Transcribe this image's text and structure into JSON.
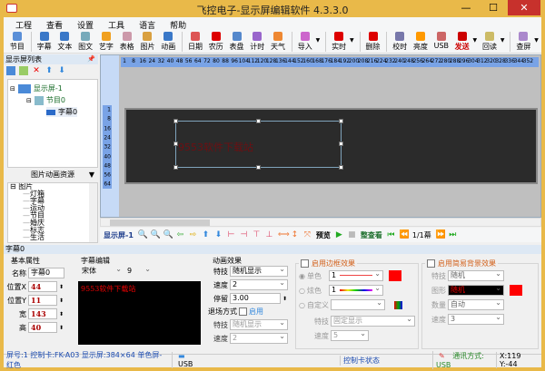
{
  "window": {
    "title": "飞控电子-显示屏编辑软件 4.3.3.0",
    "minimize": "—",
    "maximize": "☐",
    "close": "✕"
  },
  "menu": [
    "工程",
    "查看",
    "设置",
    "工具",
    "语言",
    "帮助"
  ],
  "toolbar": [
    {
      "label": "节目",
      "icon": "program-icon",
      "color": "#5a8fd8"
    },
    {
      "sep": true
    },
    {
      "label": "字幕",
      "icon": "subtitle-icon",
      "color": "#3a78c8"
    },
    {
      "label": "文本",
      "icon": "text-icon",
      "color": "#3a78c8"
    },
    {
      "label": "图文",
      "icon": "image-text-icon",
      "color": "#7ab"
    },
    {
      "label": "艺字",
      "icon": "art-text-icon",
      "color": "#f0a020"
    },
    {
      "label": "表格",
      "icon": "table-icon",
      "color": "#c9a"
    },
    {
      "label": "图片",
      "icon": "picture-icon",
      "color": "#d9a040"
    },
    {
      "label": "动画",
      "icon": "animation-icon",
      "color": "#3a78c8"
    },
    {
      "sep": true
    },
    {
      "label": "日期",
      "icon": "date-icon",
      "color": "#d55"
    },
    {
      "label": "农历",
      "icon": "lunar-icon",
      "color": "#d00"
    },
    {
      "label": "表盘",
      "icon": "clock-icon",
      "color": "#58c"
    },
    {
      "label": "计时",
      "icon": "timer-icon",
      "color": "#96c"
    },
    {
      "label": "天气",
      "icon": "weather-icon",
      "color": "#e83"
    },
    {
      "sep": true
    },
    {
      "label": "导入",
      "icon": "import-icon",
      "color": "#c6c",
      "dropdown": true
    },
    {
      "sep": true
    },
    {
      "label": "实时",
      "icon": "realtime-icon",
      "color": "#d00",
      "dropdown": true
    },
    {
      "sep": true
    },
    {
      "label": "删除",
      "icon": "delete-icon",
      "color": "#d00"
    },
    {
      "sep": true
    },
    {
      "label": "校时",
      "icon": "time-sync-icon",
      "color": "#77a"
    },
    {
      "label": "亮度",
      "icon": "brightness-icon",
      "color": "#f90"
    },
    {
      "label": "USB",
      "icon": "usb-icon",
      "color": "#c66"
    },
    {
      "label": "发送",
      "icon": "send-icon",
      "color": "#c00",
      "dropdown": true
    },
    {
      "label": "回读",
      "icon": "readback-icon",
      "color": "#cb6",
      "dropdown": true
    },
    {
      "sep": true
    },
    {
      "label": "查屏",
      "icon": "find-screen-icon",
      "color": "#a8c",
      "dropdown": true
    }
  ],
  "screen_list": {
    "title": "显示屏列表",
    "pin": "📌",
    "tree": {
      "screen": "显示屏-1",
      "program": "节目0",
      "subtitle": "字幕0"
    }
  },
  "resources": {
    "title": "图片动画资源",
    "root": "图片",
    "items": [
      "灯箱",
      "字幕",
      "运动",
      "节目",
      "婚庆",
      "标志",
      "生活"
    ]
  },
  "ruler": {
    "top_step": 8,
    "top_max": 352,
    "left_step": 8,
    "left_max": 64
  },
  "canvas": {
    "text": "9553软件下载站",
    "text_color": "#6d0f12"
  },
  "canvas_toolbar": {
    "screen": "显示屏-1",
    "preview": "预览",
    "overview": "整查看",
    "page": "1/1幕"
  },
  "props": {
    "title": "字幕0",
    "basic": {
      "title": "基本属性",
      "name_label": "名称",
      "name": "字幕0",
      "x_label": "位置X",
      "x": "44",
      "y_label": "位置Y",
      "y": "11",
      "w_label": "宽",
      "w": "143",
      "h_label": "高",
      "h": "40"
    },
    "edit": {
      "title": "字幕编辑",
      "font": "宋体",
      "size": "9",
      "text": "9553软件下载站"
    },
    "anim": {
      "title": "动画效果",
      "effect_label": "特技",
      "effect": "随机显示",
      "speed_label": "速度",
      "speed": "2",
      "stay_label": "停留",
      "stay": "3.00",
      "exit_label": "退场方式",
      "enable": "启用",
      "exit_effect_label": "特技",
      "exit_effect": "随机显示",
      "exit_speed_label": "速度",
      "exit_speed": "2"
    },
    "border": {
      "title": "启用边框效果",
      "single": "单色",
      "colorful": "炫色",
      "custom": "自定义",
      "w1": "1",
      "w2": "1",
      "effect_label": "特技",
      "effect": "固定显示",
      "speed_label": "速度",
      "speed": "5",
      "color": "#ff0000"
    },
    "bg": {
      "title": "启用简易背景效果",
      "effect_label": "特技",
      "effect": "随机",
      "shape_label": "图形",
      "shape": "随机",
      "count_label": "数量",
      "count": "自动",
      "speed_label": "速度",
      "speed": "3",
      "color": "#ff0000"
    }
  },
  "status": {
    "info": "屏号:1 控制卡:FK-A03 显示屏:384×64 单色屏-红色",
    "usb": "USB",
    "card_status": "控制卡状态",
    "comm": "通讯方式: USB",
    "coords": "X:119 Y:-44"
  }
}
